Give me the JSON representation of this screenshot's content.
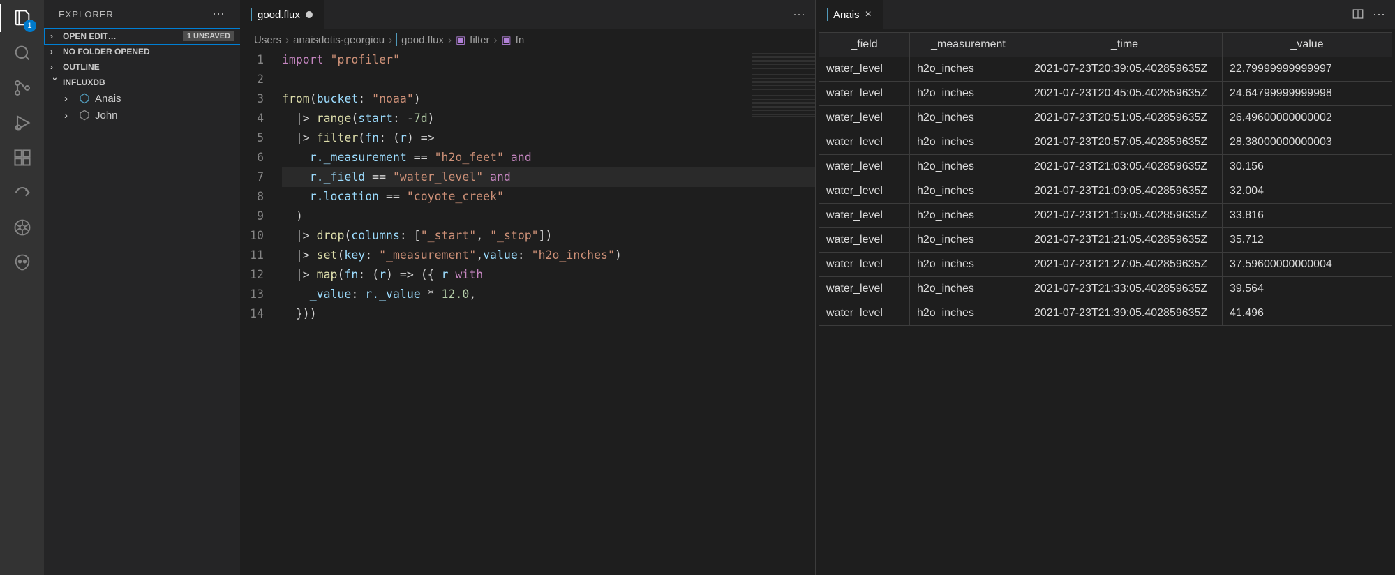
{
  "sidebar_title": "EXPLORER",
  "sections": {
    "open_editors": "OPEN EDIT…",
    "unsaved_badge": "1 UNSAVED",
    "no_folder": "NO FOLDER OPENED",
    "outline": "OUTLINE",
    "influxdb": "INFLUXDB"
  },
  "tree": {
    "anais": "Anais",
    "john": "John"
  },
  "activity_badge": "1",
  "editor": {
    "tab_label": "good.flux",
    "breadcrumb": [
      "Users",
      "anaisdotis-georgiou",
      "good.flux",
      "filter",
      "fn"
    ],
    "line_numbers": [
      "1",
      "2",
      "3",
      "4",
      "5",
      "6",
      "7",
      "8",
      "9",
      "10",
      "11",
      "12",
      "13",
      "14"
    ],
    "code_lines": [
      {
        "tokens": [
          [
            "kw",
            "import"
          ],
          [
            "op",
            " "
          ],
          [
            "str",
            "\"profiler\""
          ]
        ]
      },
      {
        "tokens": []
      },
      {
        "tokens": [
          [
            "call",
            "from"
          ],
          [
            "op",
            "("
          ],
          [
            "id",
            "bucket"
          ],
          [
            "op",
            ": "
          ],
          [
            "str",
            "\"noaa\""
          ],
          [
            "op",
            ")"
          ]
        ]
      },
      {
        "tokens": [
          [
            "op",
            "  |> "
          ],
          [
            "call",
            "range"
          ],
          [
            "op",
            "("
          ],
          [
            "id",
            "start"
          ],
          [
            "op",
            ": "
          ],
          [
            "op",
            "-"
          ],
          [
            "num",
            "7d"
          ],
          [
            "op",
            ")"
          ]
        ]
      },
      {
        "tokens": [
          [
            "op",
            "  |> "
          ],
          [
            "call",
            "filter"
          ],
          [
            "op",
            "("
          ],
          [
            "id",
            "fn"
          ],
          [
            "op",
            ": ("
          ],
          [
            "id",
            "r"
          ],
          [
            "op",
            ") =>"
          ]
        ]
      },
      {
        "tokens": [
          [
            "op",
            "    "
          ],
          [
            "id",
            "r._measurement"
          ],
          [
            "op",
            " == "
          ],
          [
            "str",
            "\"h2o_feet\""
          ],
          [
            "op",
            " "
          ],
          [
            "kw",
            "and"
          ]
        ]
      },
      {
        "hl": true,
        "tokens": [
          [
            "op",
            "    "
          ],
          [
            "id",
            "r._field"
          ],
          [
            "op",
            " == "
          ],
          [
            "str",
            "\"water_level\""
          ],
          [
            "op",
            " "
          ],
          [
            "kw",
            "and"
          ]
        ]
      },
      {
        "tokens": [
          [
            "op",
            "    "
          ],
          [
            "id",
            "r.location"
          ],
          [
            "op",
            " == "
          ],
          [
            "str",
            "\"coyote_creek\""
          ]
        ]
      },
      {
        "tokens": [
          [
            "op",
            "  )"
          ]
        ]
      },
      {
        "tokens": [
          [
            "op",
            "  |> "
          ],
          [
            "call",
            "drop"
          ],
          [
            "op",
            "("
          ],
          [
            "id",
            "columns"
          ],
          [
            "op",
            ": ["
          ],
          [
            "str",
            "\"_start\""
          ],
          [
            "op",
            ", "
          ],
          [
            "str",
            "\"_stop\""
          ],
          [
            "op",
            "])"
          ]
        ]
      },
      {
        "tokens": [
          [
            "op",
            "  |> "
          ],
          [
            "call",
            "set"
          ],
          [
            "op",
            "("
          ],
          [
            "id",
            "key"
          ],
          [
            "op",
            ": "
          ],
          [
            "str",
            "\"_measurement\""
          ],
          [
            "op",
            ","
          ],
          [
            "id",
            "value"
          ],
          [
            "op",
            ": "
          ],
          [
            "str",
            "\"h2o_inches\""
          ],
          [
            "op",
            ")"
          ]
        ]
      },
      {
        "tokens": [
          [
            "op",
            "  |> "
          ],
          [
            "call",
            "map"
          ],
          [
            "op",
            "("
          ],
          [
            "id",
            "fn"
          ],
          [
            "op",
            ": ("
          ],
          [
            "id",
            "r"
          ],
          [
            "op",
            ") => ({ "
          ],
          [
            "id",
            "r"
          ],
          [
            "op",
            " "
          ],
          [
            "kw",
            "with"
          ]
        ]
      },
      {
        "tokens": [
          [
            "op",
            "    "
          ],
          [
            "id",
            "_value"
          ],
          [
            "op",
            ": "
          ],
          [
            "id",
            "r._value"
          ],
          [
            "op",
            " * "
          ],
          [
            "num",
            "12.0"
          ],
          [
            "op",
            ","
          ]
        ]
      },
      {
        "tokens": [
          [
            "op",
            "  }))"
          ]
        ]
      }
    ]
  },
  "data_tab": "Anais",
  "table": {
    "headers": [
      "_field",
      "_measurement",
      "_time",
      "_value"
    ],
    "rows": [
      [
        "water_level",
        "h2o_inches",
        "2021-07-23T20:39:05.402859635Z",
        "22.79999999999997"
      ],
      [
        "water_level",
        "h2o_inches",
        "2021-07-23T20:45:05.402859635Z",
        "24.64799999999998"
      ],
      [
        "water_level",
        "h2o_inches",
        "2021-07-23T20:51:05.402859635Z",
        "26.49600000000002"
      ],
      [
        "water_level",
        "h2o_inches",
        "2021-07-23T20:57:05.402859635Z",
        "28.38000000000003"
      ],
      [
        "water_level",
        "h2o_inches",
        "2021-07-23T21:03:05.402859635Z",
        "30.156"
      ],
      [
        "water_level",
        "h2o_inches",
        "2021-07-23T21:09:05.402859635Z",
        "32.004"
      ],
      [
        "water_level",
        "h2o_inches",
        "2021-07-23T21:15:05.402859635Z",
        "33.816"
      ],
      [
        "water_level",
        "h2o_inches",
        "2021-07-23T21:21:05.402859635Z",
        "35.712"
      ],
      [
        "water_level",
        "h2o_inches",
        "2021-07-23T21:27:05.402859635Z",
        "37.59600000000004"
      ],
      [
        "water_level",
        "h2o_inches",
        "2021-07-23T21:33:05.402859635Z",
        "39.564"
      ],
      [
        "water_level",
        "h2o_inches",
        "2021-07-23T21:39:05.402859635Z",
        "41.496"
      ]
    ]
  }
}
